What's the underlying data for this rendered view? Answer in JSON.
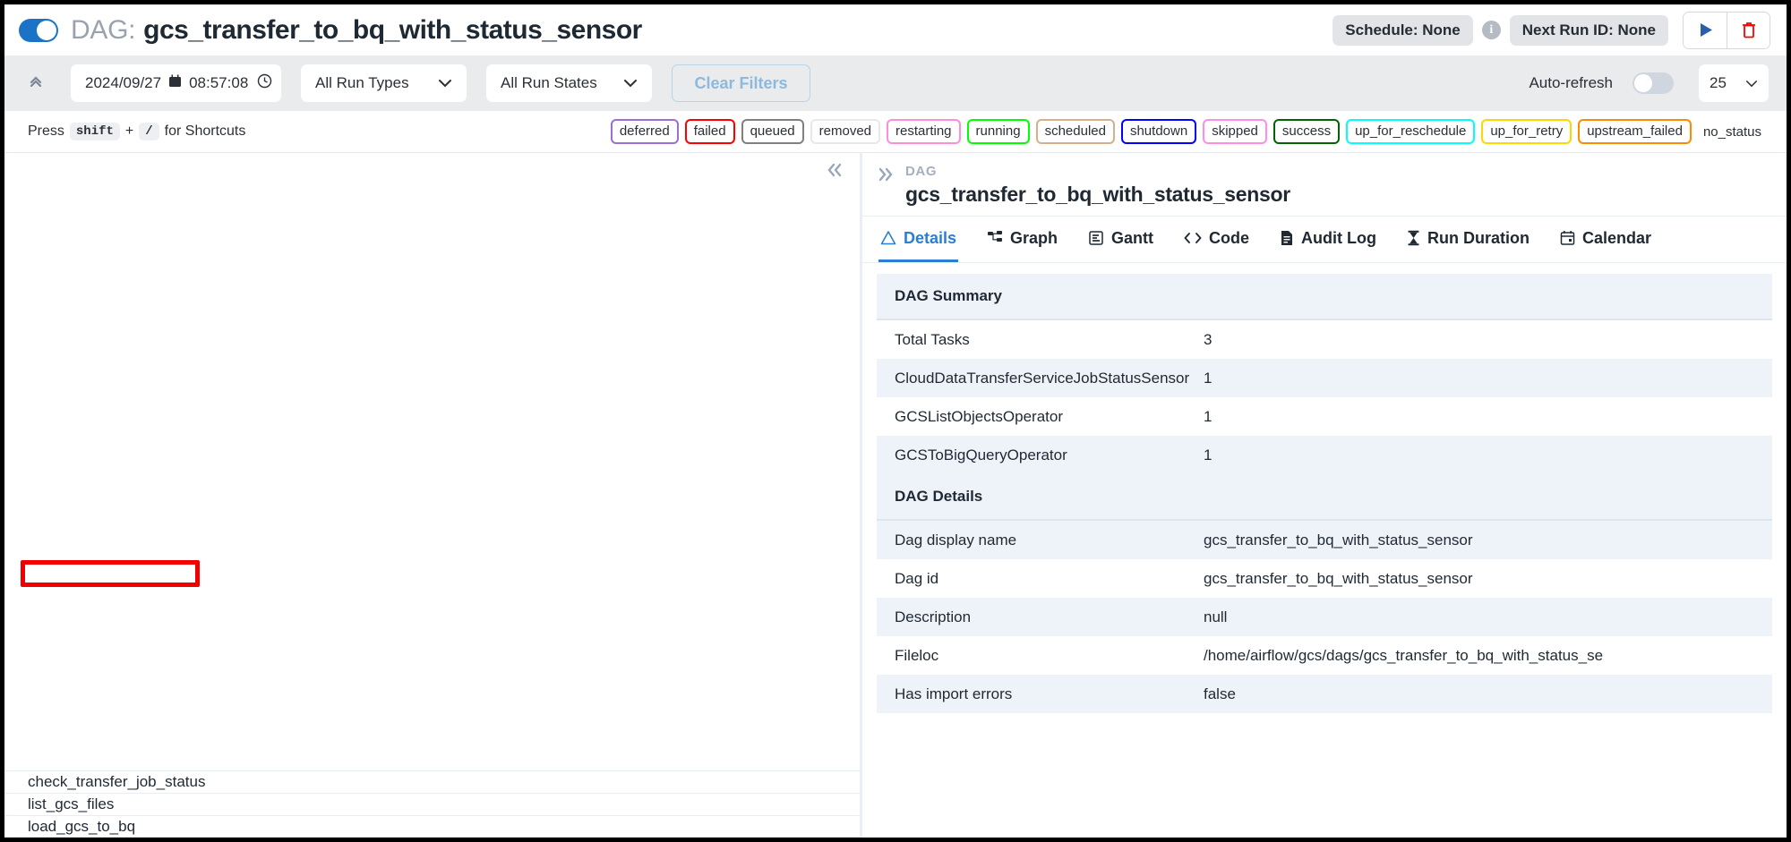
{
  "header": {
    "toggle_name": "dag-pause-toggle",
    "dag_label": "DAG:",
    "dag_name": "gcs_transfer_to_bq_with_status_sensor",
    "schedule_pill": "Schedule: None",
    "info_glyph": "i",
    "next_run_pill": "Next Run ID: None",
    "trigger_icon": "play-icon",
    "delete_icon": "trash-icon",
    "accent_blue": "#2a7fd4",
    "delete_red": "#ff0000"
  },
  "filters": {
    "collapse_glyph": "«",
    "date_value": "2024/09/27",
    "time_value": "08:57:08",
    "calendar_icon": "calendar-icon",
    "clock_icon": "clock-icon",
    "run_types": "All Run Types",
    "run_states": "All Run States",
    "clear_filters": "Clear Filters",
    "auto_refresh_label": "Auto-refresh",
    "auto_refresh_on": false,
    "page_size": "25",
    "chevron": "∨"
  },
  "legend": {
    "shortcut_prefix": "Press",
    "shortcut_key1": "shift",
    "shortcut_plus": "+",
    "shortcut_key2": "/",
    "shortcut_suffix": "for Shortcuts",
    "chips": [
      {
        "label": "deferred",
        "color": "#9a70d6"
      },
      {
        "label": "failed",
        "color": "#ff0000"
      },
      {
        "label": "queued",
        "color": "#808080"
      },
      {
        "label": "removed",
        "color": "#e8e8e8"
      },
      {
        "label": "restarting",
        "color": "#fe8ddb"
      },
      {
        "label": "running",
        "color": "#00ff00"
      },
      {
        "label": "scheduled",
        "color": "#d3b municipio"
      },
      {
        "label": "shutdown",
        "color": "#0000ff"
      },
      {
        "label": "skipped",
        "color": "#ff8ce8"
      },
      {
        "label": "success",
        "color": "#006400"
      },
      {
        "label": "up_for_reschedule",
        "color": "#00ffff"
      },
      {
        "label": "up_for_retry",
        "color": "#ffd700"
      },
      {
        "label": "upstream_failed",
        "color": "#ff8c00"
      }
    ],
    "no_status": "no_status"
  },
  "grid": {
    "collapse_glyph": "«",
    "tasks": [
      "check_transfer_job_status",
      "list_gcs_files",
      "load_gcs_to_bq"
    ],
    "highlighted_task": "check_transfer_job_status",
    "highlight_color": "#f00000"
  },
  "detail_panel": {
    "expand_glyph": "»",
    "breadcrumb": "DAG",
    "title": "gcs_transfer_to_bq_with_status_sensor",
    "tabs": [
      {
        "label": "Details",
        "icon": "warning-triangle-icon",
        "active": true
      },
      {
        "label": "Graph",
        "icon": "graph-icon",
        "active": false
      },
      {
        "label": "Gantt",
        "icon": "gantt-icon",
        "active": false
      },
      {
        "label": "Code",
        "icon": "code-icon",
        "active": false
      },
      {
        "label": "Audit Log",
        "icon": "document-icon",
        "active": false
      },
      {
        "label": "Run Duration",
        "icon": "hourglass-icon",
        "active": false
      },
      {
        "label": "Calendar",
        "icon": "calendar-icon",
        "active": false
      }
    ],
    "summary_heading": "DAG Summary",
    "summary_rows": [
      {
        "key": "Total Tasks",
        "value": "3"
      },
      {
        "key": "CloudDataTransferServiceJobStatusSensor",
        "value": "1"
      },
      {
        "key": "GCSListObjectsOperator",
        "value": "1"
      },
      {
        "key": "GCSToBigQueryOperator",
        "value": "1"
      }
    ],
    "details_heading": "DAG Details",
    "details_rows": [
      {
        "key": "Dag display name",
        "value": "gcs_transfer_to_bq_with_status_sensor"
      },
      {
        "key": "Dag id",
        "value": "gcs_transfer_to_bq_with_status_sensor"
      },
      {
        "key": "Description",
        "value": "null"
      },
      {
        "key": "Fileloc",
        "value": "/home/airflow/gcs/dags/gcs_transfer_to_bq_with_status_se"
      },
      {
        "key": "Has import errors",
        "value": "false"
      }
    ]
  }
}
